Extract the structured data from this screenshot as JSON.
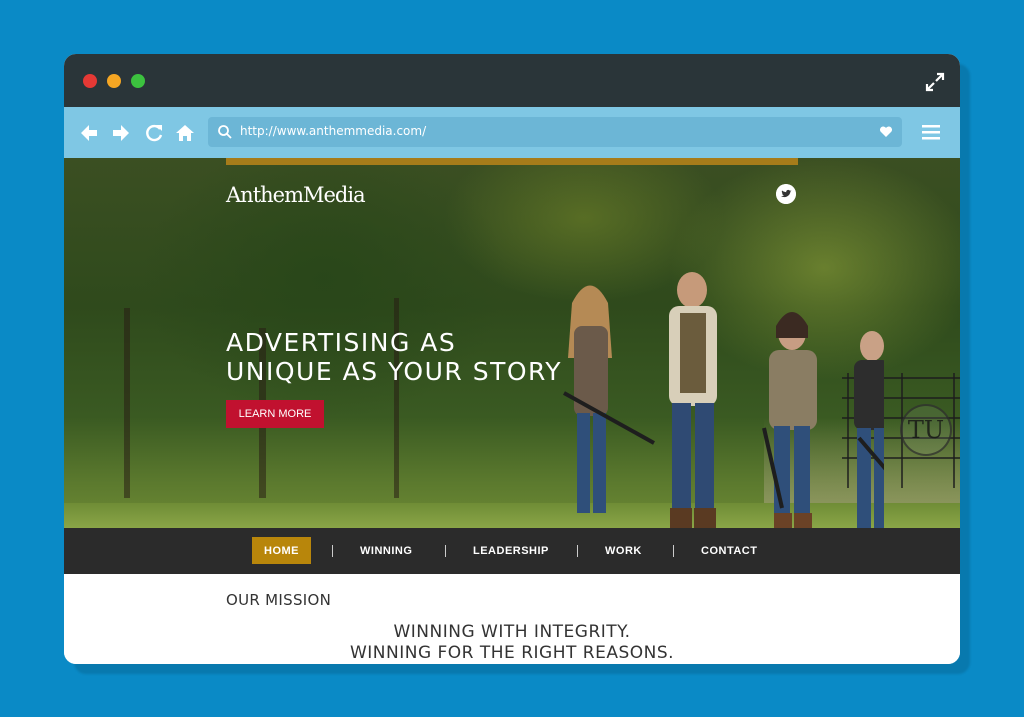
{
  "browser": {
    "url": "http://www.anthemmedia.com/",
    "icons": [
      "back-icon",
      "forward-icon",
      "reload-icon",
      "home-icon",
      "search-icon",
      "heart-icon",
      "menu-icon",
      "expand-icon"
    ]
  },
  "site": {
    "logo_text": "AnthemMedia",
    "hero": {
      "headline_line1": "ADVERTISING AS",
      "headline_line2": "UNIQUE AS YOUR STORY",
      "cta_label": "LEARN MORE"
    },
    "nav": {
      "items": [
        {
          "label": "HOME",
          "active": true
        },
        {
          "label": "WINNING",
          "active": false
        },
        {
          "label": "LEADERSHIP",
          "active": false
        },
        {
          "label": "WORK",
          "active": false
        },
        {
          "label": "CONTACT",
          "active": false
        }
      ]
    },
    "mission": {
      "title": "OUR MISSION",
      "line1": "WINNING WITH INTEGRITY.",
      "line2": "WINNING FOR THE RIGHT REASONS."
    },
    "colors": {
      "page_bg": "#0a8ac6",
      "titlebar": "#2a3539",
      "toolbar": "#7fc7e4",
      "accent_gold": "#b8860b",
      "cta_red": "#c1112f",
      "nav_bg": "#2b2b2b"
    }
  }
}
